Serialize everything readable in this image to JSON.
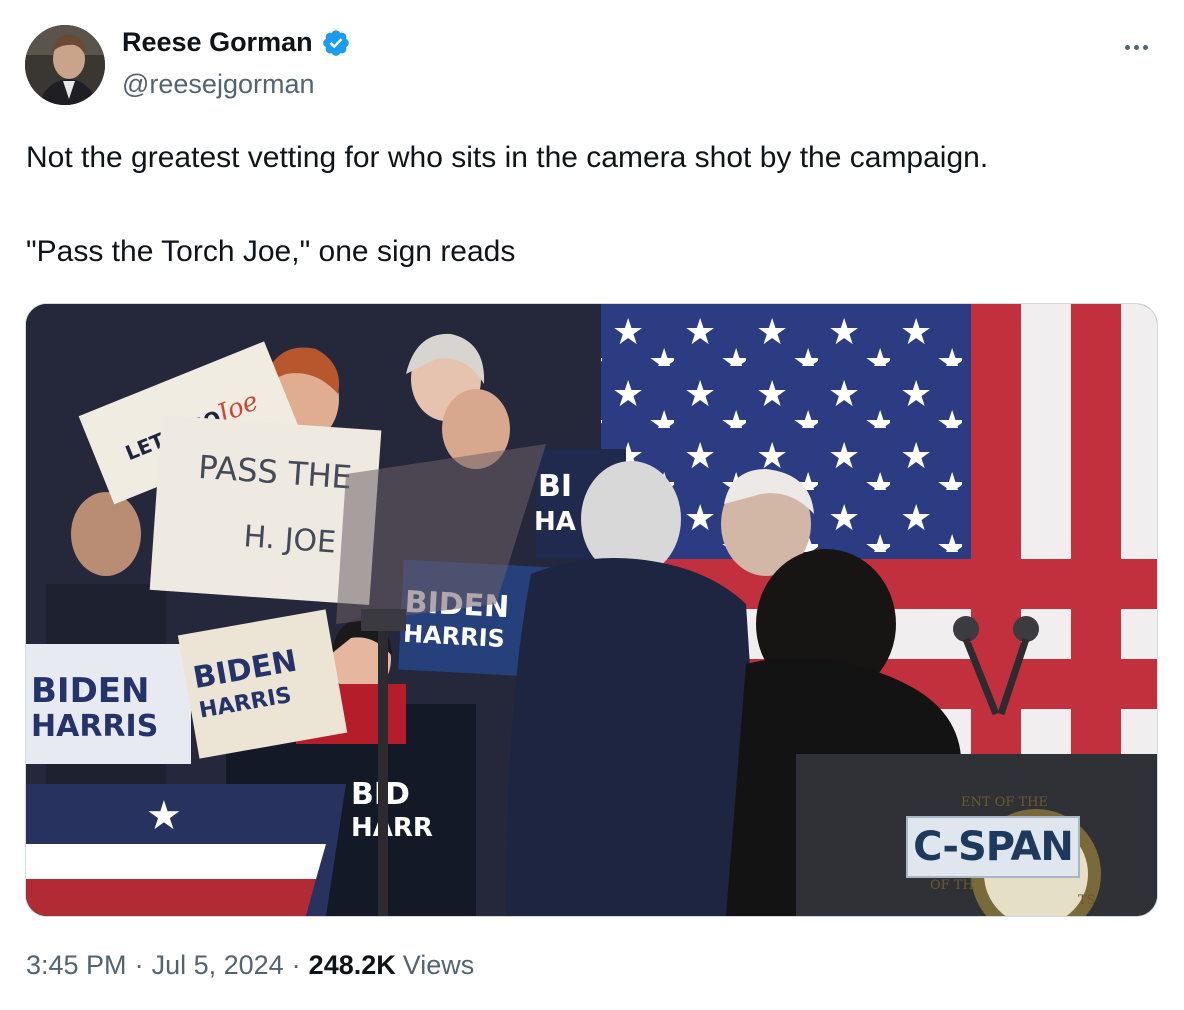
{
  "author": {
    "name": "Reese Gorman",
    "handle": "@reesejgorman",
    "verified": true,
    "verified_color": "#1d9bf0"
  },
  "tweet": {
    "text_line1": "Not the greatest vetting for who sits in the camera shot by the campaign.",
    "text_line2": "\"Pass the Torch Joe,\" one sign reads"
  },
  "media": {
    "signs": {
      "lets_go": "LET'S GO",
      "lets_go_script": "Joe",
      "pass_line1": "PASS THE",
      "pass_line2": "H. JOE",
      "biden": "BIDEN",
      "harris": "HARRIS",
      "biden_partial_1": "BI",
      "harris_partial_1": "HA",
      "biden_partial_2": "BID",
      "harris_partial_2": "HARR"
    },
    "watermark": "C-SPAN",
    "seal_text_top": "ENT OF THE",
    "seal_text_left": "OF TH",
    "seal_text_right": "TS"
  },
  "meta": {
    "time": "3:45 PM",
    "date": "Jul 5, 2024",
    "views_count": "248.2K",
    "views_label": "Views",
    "separator": "·"
  },
  "icons": {
    "more": "more-icon",
    "verified": "verified-badge-icon"
  }
}
